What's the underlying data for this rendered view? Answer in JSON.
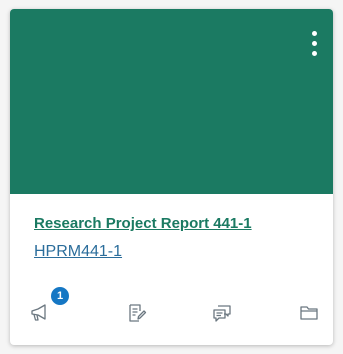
{
  "card": {
    "title": "Research Project Report 441-1",
    "code": "HPRM441-1",
    "color": "#1b7a62",
    "menu_icon": "kebab-menu-icon"
  },
  "actions": [
    {
      "icon": "megaphone-icon",
      "name": "announcements",
      "badge": "1"
    },
    {
      "icon": "assignment-edit-icon",
      "name": "assignments"
    },
    {
      "icon": "discussion-icon",
      "name": "discussions"
    },
    {
      "icon": "folder-icon",
      "name": "files"
    }
  ]
}
